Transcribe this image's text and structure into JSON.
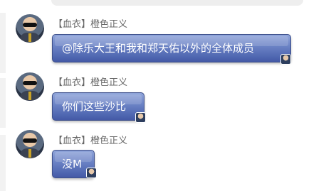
{
  "messages": [
    {
      "sender": "【血衣】橙色正义",
      "text": "@除乐大王和我和郑天佑以外的全体成员"
    },
    {
      "sender": "【血衣】橙色正义",
      "text": "你们这些沙比"
    },
    {
      "sender": "【血衣】橙色正义",
      "text": "没M"
    }
  ],
  "icons": {
    "avatar": "avatar-icon",
    "bubble_badge": "bubble-avatar-icon"
  },
  "colors": {
    "bubble_top": "#90a5da",
    "bubble_bottom": "#4459a6",
    "sender_text": "#666666"
  }
}
